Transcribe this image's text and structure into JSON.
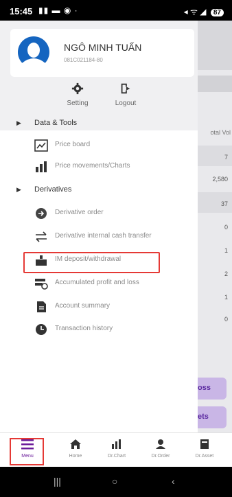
{
  "statusbar": {
    "time": "15:45",
    "battery": "87"
  },
  "user": {
    "name": "NGÔ MINH TUẤN",
    "account_id": "081C021184-80"
  },
  "header_buttons": {
    "setting": "Setting",
    "logout": "Logout"
  },
  "sections": {
    "data_tools": "Data & Tools",
    "derivatives": "Derivatives"
  },
  "data_tools_items": {
    "price_board": "Price board",
    "price_movements": "Price movements/Charts"
  },
  "derivative_items": {
    "derivative_order": "Derivative order",
    "internal_transfer": "Derivative internal cash transfer",
    "im_deposit": "IM deposit/withdrawal",
    "accumulated_pl": "Accumulated profit and loss",
    "account_summary": "Account summary",
    "transaction_history": "Transaction history"
  },
  "background": {
    "column_header": "otal Vol",
    "values": [
      "7",
      "2,580",
      "37",
      "0",
      "1",
      "2",
      "1",
      "0"
    ],
    "button1": "oss",
    "button2": "ets"
  },
  "bottom_nav": {
    "menu": "Menu",
    "home": "Home",
    "drchart": "Dr.Chart",
    "drorder": "Dr.Order",
    "drasset": "Dr.Asset"
  },
  "colors": {
    "accent": "#6a1b9a",
    "highlight": "#e53935",
    "avatar": "#1565c0"
  }
}
